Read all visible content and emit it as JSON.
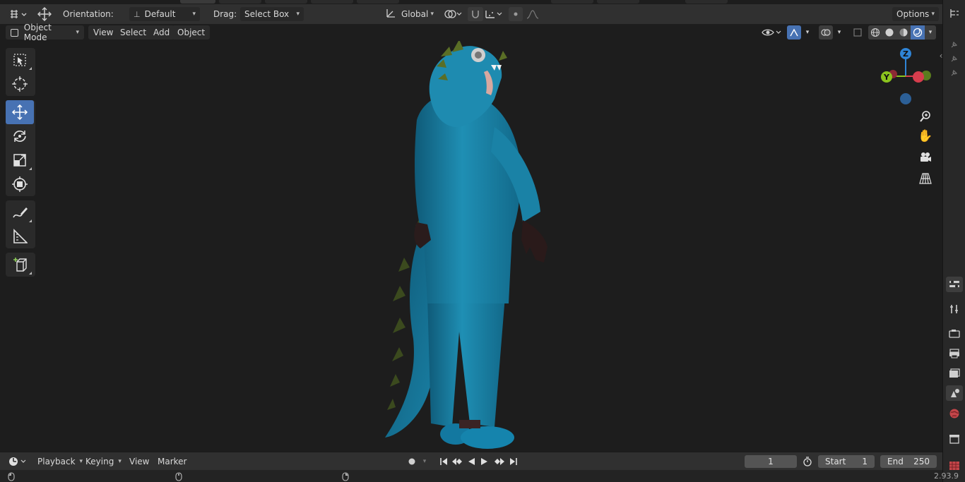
{
  "header": {
    "orientation_label": "Orientation:",
    "orientation_value": "Default",
    "drag_label": "Drag:",
    "drag_value": "Select Box",
    "transform_space": "Global",
    "options_label": "Options"
  },
  "menu": {
    "mode": "Object Mode",
    "items": [
      "View",
      "Select",
      "Add",
      "Object"
    ]
  },
  "gizmo": {
    "z_label": "Z",
    "y_label": "Y"
  },
  "timeline": {
    "menus": [
      "Playback",
      "Keying",
      "View",
      "Marker"
    ],
    "current_frame": "1",
    "start_label": "Start",
    "start_value": "1",
    "end_label": "End",
    "end_value": "250"
  },
  "status": {
    "version": "2.93.9"
  },
  "icons": {
    "select_tool": "select-box-icon",
    "cursor_tool": "cursor-icon",
    "move_tool": "move-icon",
    "rotate_tool": "rotate-icon",
    "scale_tool": "scale-icon",
    "transform_tool": "transform-icon",
    "annotate_tool": "annotate-icon",
    "measure_tool": "measure-icon",
    "add_cube_tool": "add-cube-icon"
  },
  "colors": {
    "accent": "#4772b3",
    "axis_x": "#d63d4d",
    "axis_y": "#8bc31e",
    "axis_z": "#2f84d6",
    "character": "#1f8fb4"
  }
}
